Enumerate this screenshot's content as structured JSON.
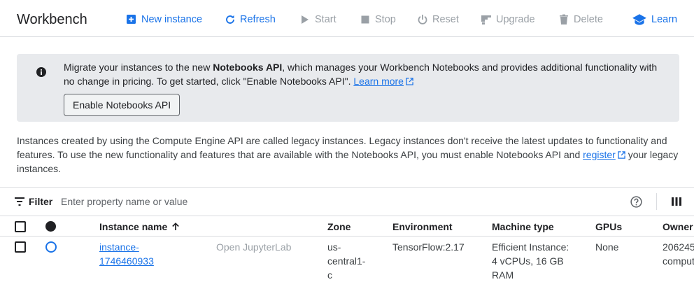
{
  "header": {
    "title": "Workbench",
    "actions": {
      "new_instance": "New instance",
      "refresh": "Refresh",
      "start": "Start",
      "stop": "Stop",
      "reset": "Reset",
      "upgrade": "Upgrade",
      "delete": "Delete",
      "learn": "Learn"
    },
    "accent_color": "#1a73e8",
    "disabled_color": "#9aa0a6"
  },
  "banner": {
    "icon": "info-icon",
    "text_before": "Migrate your instances to the new ",
    "text_bold": "Notebooks API",
    "text_after": ", which manages your Workbench Notebooks and provides additional functionality with no change in pricing. To get started, click \"Enable Notebooks API\". ",
    "learn_more": "Learn more",
    "button": "Enable Notebooks API"
  },
  "description": {
    "text_before": "Instances created by using the Compute Engine API are called legacy instances. Legacy instances don't receive the latest updates to functionality and features. To use the new functionality and features that are available with the Notebooks API, you must enable Notebooks API and ",
    "link": "register",
    "text_after": " your legacy instances."
  },
  "filter": {
    "label": "Filter",
    "placeholder": "Enter property name or value"
  },
  "table": {
    "columns": {
      "name": "Instance name",
      "zone": "Zone",
      "environment": "Environment",
      "machine_type": "Machine type",
      "gpus": "GPUs",
      "owner": "Owner"
    },
    "rows": [
      {
        "name": "instance-1746460933",
        "name_line1": "instance-",
        "name_line2": "1746460933",
        "open_action": "Open JupyterLab",
        "zone_line1": "us-",
        "zone_line2": "central1-",
        "zone_line3": "c",
        "environment": "TensorFlow:2.17",
        "machine_line1": "Efficient Instance:",
        "machine_line2": "4 vCPUs, 16 GB",
        "machine_line3": "RAM",
        "gpus": "None",
        "owner_line1": "206245",
        "owner_line2": "comput"
      }
    ]
  }
}
